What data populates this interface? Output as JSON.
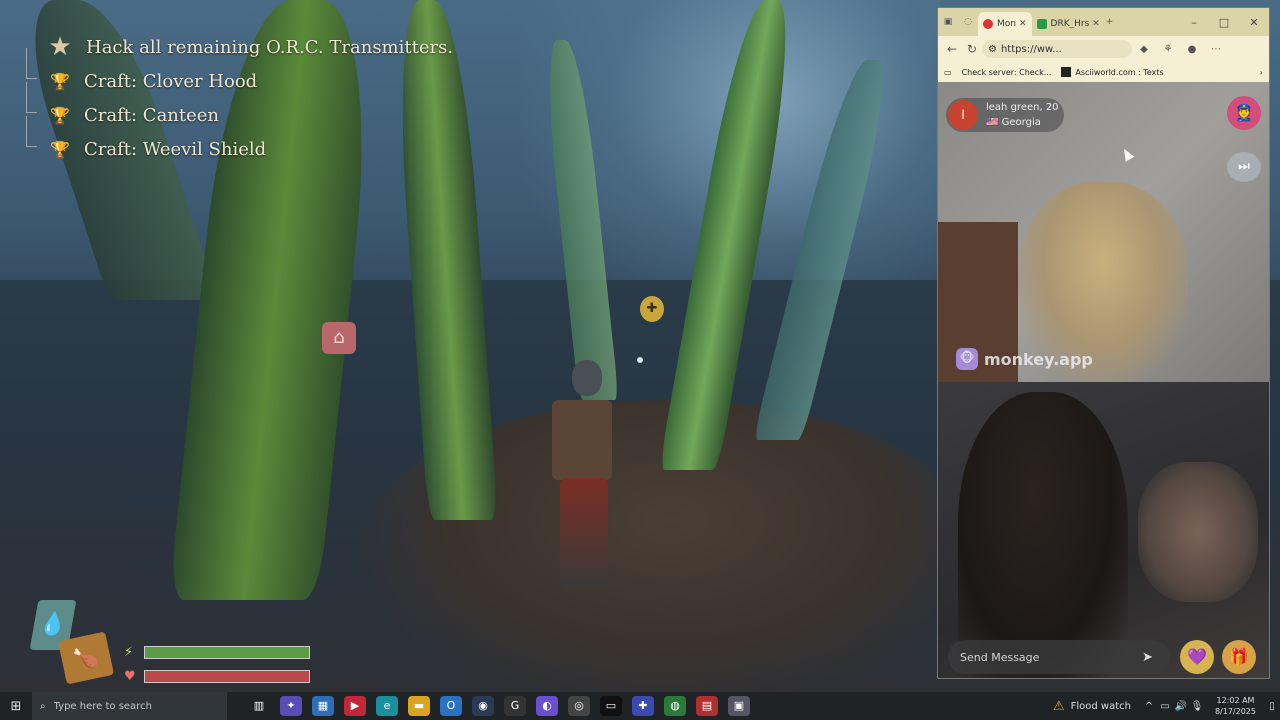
{
  "quests": [
    {
      "icon": "star-icon",
      "text": "Hack all remaining O.R.C. Transmitters."
    },
    {
      "icon": "trophy-icon",
      "text": "Craft: Clover Hood"
    },
    {
      "icon": "trophy-icon",
      "text": "Craft: Canteen"
    },
    {
      "icon": "trophy-icon",
      "text": "Craft: Weevil Shield"
    }
  ],
  "hud": {
    "stamina_level": 1.0,
    "health_level": 1.0,
    "stamina_color": "#5d9a45",
    "health_color": "#b84a4a"
  },
  "browser": {
    "tabs": [
      {
        "label": "Mon",
        "active": true
      },
      {
        "label": "DRK_Hrs",
        "active": false
      }
    ],
    "new_tab": "+",
    "url": "https://ww...",
    "bookmarks": [
      "Check server: Check...",
      "Asciiworld.com : Texts"
    ]
  },
  "monkey": {
    "profile_initial": "l",
    "profile_name": "leah green, 20",
    "profile_flag": "🇺🇸",
    "profile_location": "Georgia",
    "brand": "monkey.app",
    "message_placeholder": "Send Message"
  },
  "taskbar": {
    "search_placeholder": "Type here to search",
    "weather": "Flood watch",
    "time": "12:02 AM",
    "date": "8/17/2025"
  }
}
